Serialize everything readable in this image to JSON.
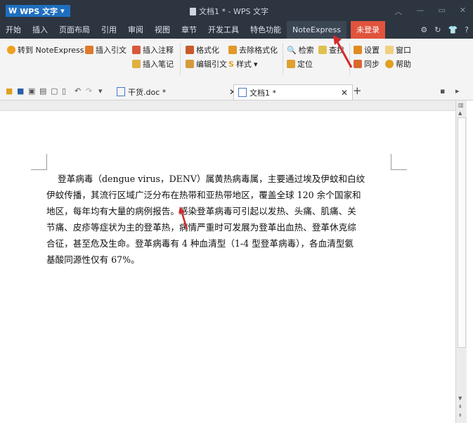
{
  "app": {
    "menu_label": "WPS 文字",
    "logo_glyph": "W",
    "dropdown": "▾"
  },
  "window": {
    "title": "文档1 * - WPS 文字"
  },
  "menu": {
    "items": [
      "开始",
      "插入",
      "页面布局",
      "引用",
      "审阅",
      "视图",
      "章节",
      "开发工具",
      "特色功能",
      "NoteExpress"
    ],
    "login": "未登录"
  },
  "ribbon": {
    "goto": "转到 NoteExpress",
    "insert_citation": "插入引文",
    "insert_note": "插入注释",
    "insert_notebook": "插入笔记",
    "format": "格式化",
    "remove_format": "去除格式化",
    "edit_citation": "编辑引文",
    "style": "样式",
    "search": "检索",
    "find": "查找",
    "locate": "定位",
    "settings": "设置",
    "window": "窗口",
    "sync": "同步",
    "help": "帮助"
  },
  "tabs": [
    {
      "label": "干货.doc *"
    },
    {
      "label": "文档1 *"
    }
  ],
  "document": {
    "lines": [
      "    登革病毒（dengue virus，DENV）属黄热病毒属，主要通过埃及伊蚊和白纹",
      "伊蚊传播，其流行区域广泛分布在热带和亚热带地区，覆盖全球 120 余个国家和",
      "地区，每年均有大量的病例报告。感染登革病毒可引起以发热、头痛、肌痛、关",
      "节痛、皮疹等症状为主的登革热，病情严重时可发展为登革出血热、登革休克综",
      "合征，甚至危及生命。登革病毒有 4 种血清型（1-4 型登革病毒），各血清型氨",
      "基酸同源性仅有 67%。"
    ]
  },
  "colors": {
    "titlebar": "#2c3540",
    "accent_blue": "#1f6fc0",
    "login_red": "#e0533c",
    "arrow_red": "#d42a2a"
  }
}
